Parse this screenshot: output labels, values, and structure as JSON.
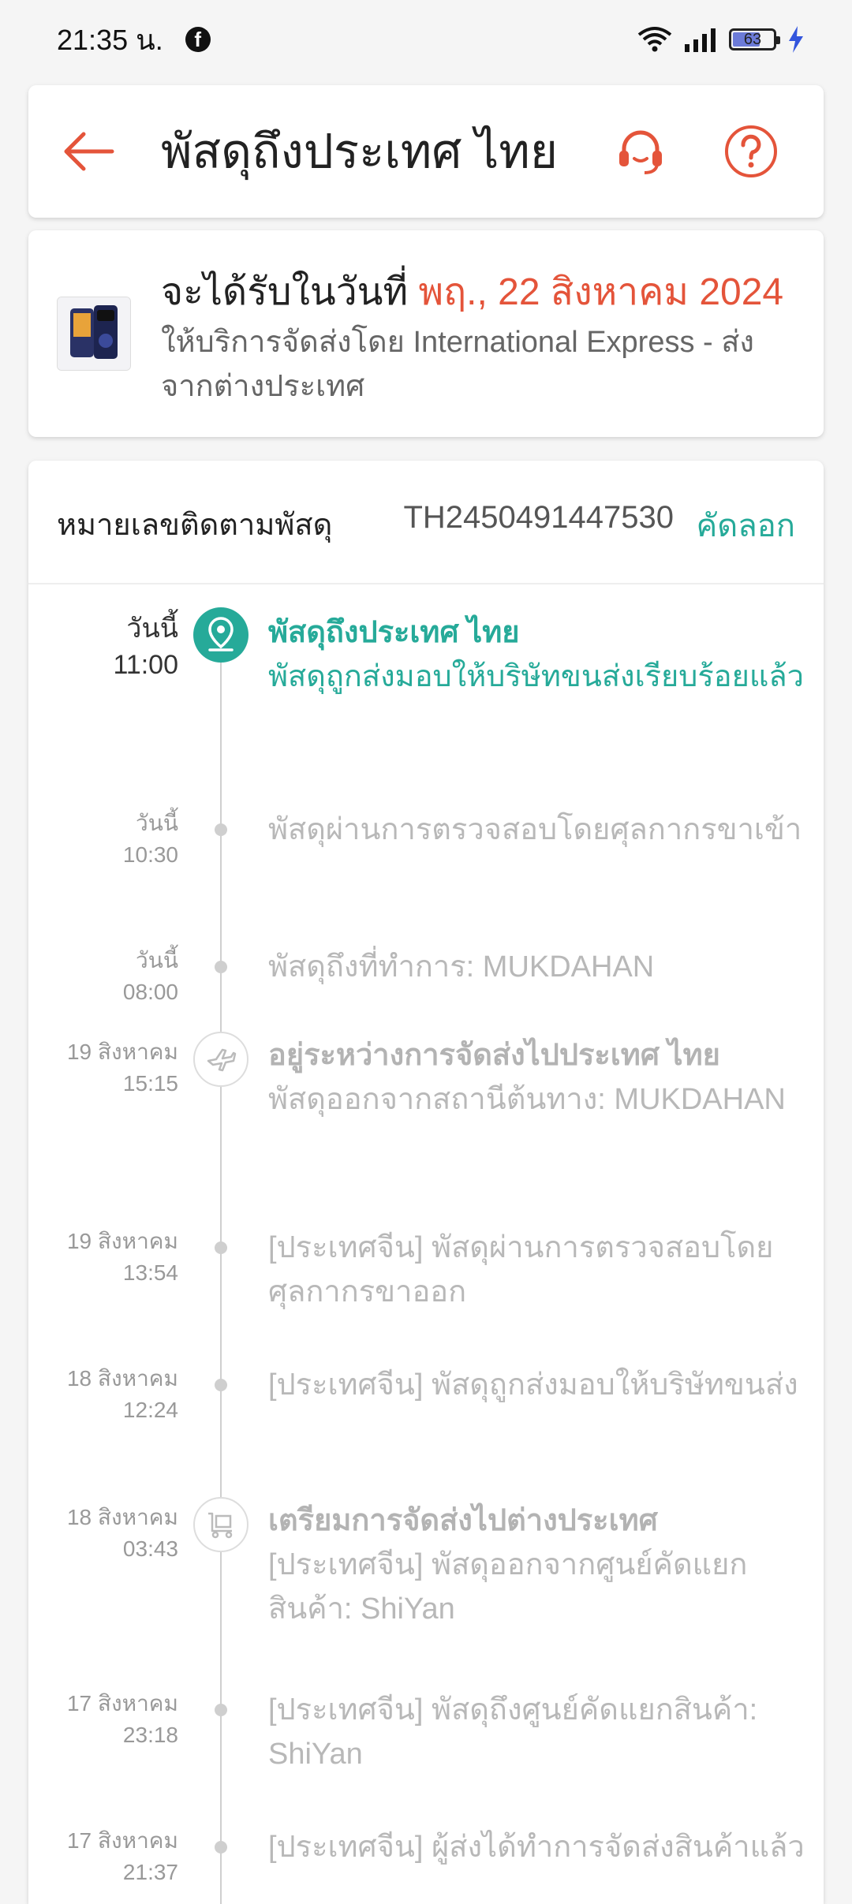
{
  "status_bar": {
    "time": "21:35 น.",
    "battery": "63"
  },
  "header": {
    "title": "พัสดุถึงประเทศ ไทย"
  },
  "delivery": {
    "prefix": "จะได้รับในวันที่ ",
    "date": "พฤ., 22 สิงหาคม 2024",
    "service": "ให้บริการจัดส่งโดย International Express - ส่งจากต่างประเทศ"
  },
  "tracking": {
    "label": "หมายเลขติดตามพัสดุ",
    "number": "TH2450491447530",
    "copy": "คัดลอก"
  },
  "events": [
    {
      "date": "วันนี้",
      "time": "11:00",
      "title": "พัสดุถึงประเทศ ไทย",
      "desc": "พัสดุถูกส่งมอบให้บริษัทขนส่งเรียบร้อยแล้ว"
    },
    {
      "date": "วันนี้",
      "time": "10:30",
      "title": "",
      "desc": "พัสดุผ่านการตรวจสอบโดยศุลกากรขาเข้า"
    },
    {
      "date": "วันนี้",
      "time": "08:00",
      "title": "",
      "desc": "พัสดุถึงที่ทำการ: MUKDAHAN"
    },
    {
      "date": "19 สิงหาคม",
      "time": "15:15",
      "title": "อยู่ระหว่างการจัดส่งไปประเทศ ไทย",
      "desc": "พัสดุออกจากสถานีต้นทาง: MUKDAHAN"
    },
    {
      "date": "19 สิงหาคม",
      "time": "13:54",
      "title": "",
      "desc": "[ประเทศจีน] พัสดุผ่านการตรวจสอบโดยศุลกากรขาออก"
    },
    {
      "date": "18 สิงหาคม",
      "time": "12:24",
      "title": "",
      "desc": "[ประเทศจีน] พัสดุถูกส่งมอบให้บริษัทขนส่ง"
    },
    {
      "date": "18 สิงหาคม",
      "time": "03:43",
      "title": "เตรียมการจัดส่งไปต่างประเทศ",
      "desc": "[ประเทศจีน] พัสดุออกจากศูนย์คัดแยกสินค้า: ShiYan"
    },
    {
      "date": "17 สิงหาคม",
      "time": "23:18",
      "title": "",
      "desc": "[ประเทศจีน] พัสดุถึงศูนย์คัดแยกสินค้า: ShiYan"
    },
    {
      "date": "17 สิงหาคม",
      "time": "21:37",
      "title": "",
      "desc": "[ประเทศจีน] ผู้ส่งได้ทำการจัดส่งสินค้าแล้ว"
    }
  ],
  "colors": {
    "accent": "#e4543a",
    "teal": "#26aa99",
    "muted": "#b8b8b8"
  }
}
